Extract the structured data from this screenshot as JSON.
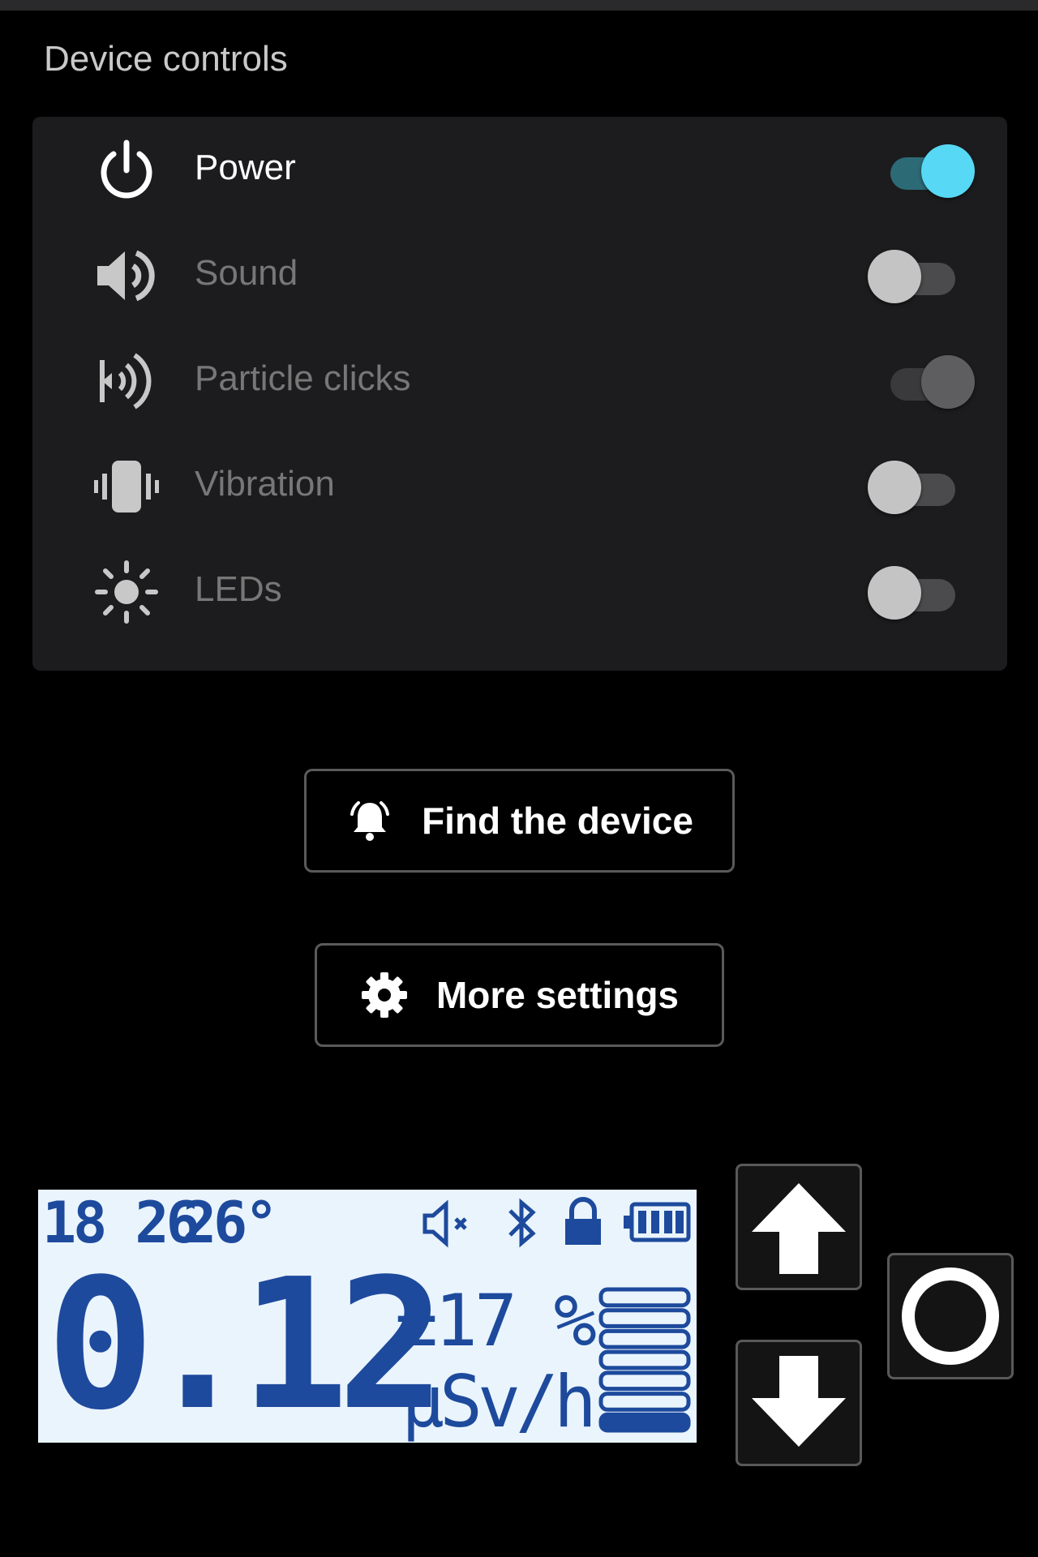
{
  "section": {
    "title": "Device controls"
  },
  "controls": [
    {
      "label": "Power",
      "icon": "power-icon",
      "on": true,
      "color": "#57d8f4"
    },
    {
      "label": "Sound",
      "icon": "speaker-icon",
      "on": false
    },
    {
      "label": "Particle clicks",
      "icon": "particle-clicks-icon",
      "on": true,
      "disabled": true
    },
    {
      "label": "Vibration",
      "icon": "vibration-icon",
      "on": false
    },
    {
      "label": "LEDs",
      "icon": "sun-icon",
      "on": false
    }
  ],
  "buttons": {
    "find_device": "Find the device",
    "more_settings": "More settings"
  },
  "lcd": {
    "time": "18 26",
    "temperature": "26°",
    "reading": "0.12",
    "uncertainty": "±17 %",
    "unit": "μSv/h",
    "battery_icon": "battery-icon",
    "bar_level_segments": 7,
    "background": "#eaf4fd",
    "text_color": "#1d4a9c"
  }
}
